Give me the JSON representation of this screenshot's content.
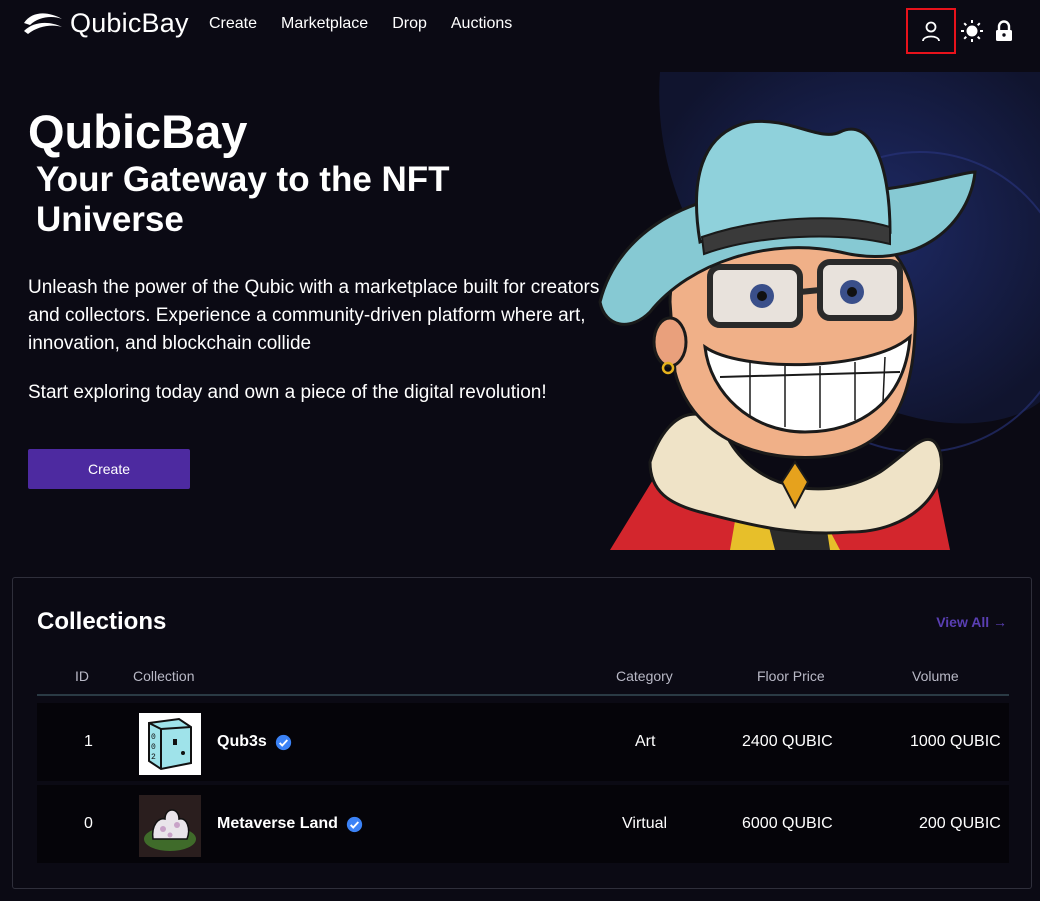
{
  "brand": {
    "name": "QubicBay"
  },
  "nav": {
    "links": [
      "Create",
      "Marketplace",
      "Drop",
      "Auctions"
    ],
    "icons": [
      "user-icon",
      "sun-icon",
      "lock-icon"
    ]
  },
  "hero": {
    "title": "QubicBay",
    "subtitle": "Your Gateway to the NFT Universe",
    "description": "Unleash the power of the Qubic with a marketplace built for creators and collectors. Experience a community-driven platform where art, innovation, and blockchain collide",
    "cta_text": "Start exploring today and own a piece of the digital revolution!",
    "button_label": "Create"
  },
  "collections": {
    "title": "Collections",
    "view_all": "View All →",
    "columns": [
      "ID",
      "Collection",
      "Category",
      "Floor Price",
      "Volume"
    ],
    "rows": [
      {
        "id": "1",
        "name": "Qub3s",
        "category": "Art",
        "floor": "2400 QUBIC",
        "volume": "1000 QUBIC"
      },
      {
        "id": "0",
        "name": "Metaverse Land",
        "category": "Virtual",
        "floor": "6000 QUBIC",
        "volume": "200 QUBIC"
      }
    ]
  },
  "colors": {
    "background": "#0b0a14",
    "accent": "#4d2aa0",
    "link": "#5a3fb4",
    "verified": "#3b82f6",
    "highlight": "#e8121b"
  }
}
